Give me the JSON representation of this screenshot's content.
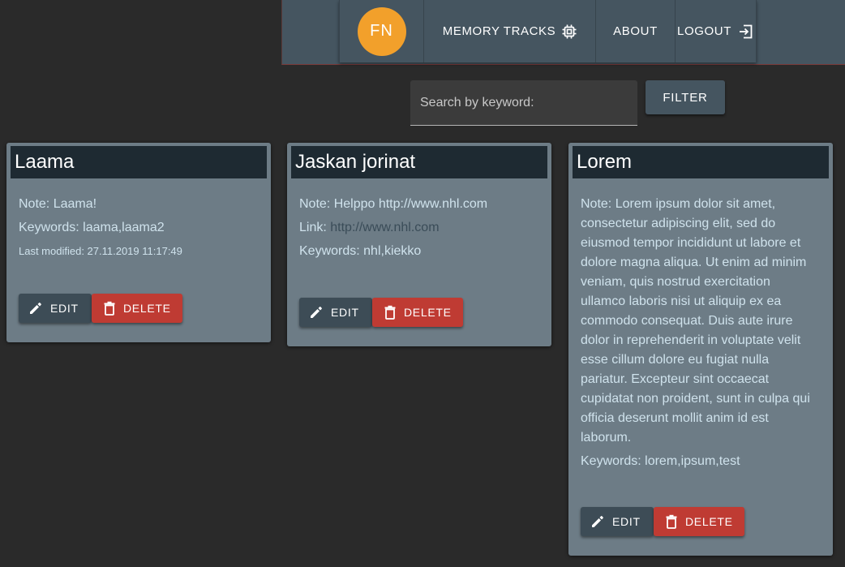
{
  "nav": {
    "avatar_initials": "FN",
    "memory_tracks_label": "MEMORY TRACKS",
    "about_label": "ABOUT",
    "logout_label": "LOGOUT",
    "icons": [
      "memory-chip-icon",
      "logout-icon"
    ]
  },
  "search": {
    "placeholder": "Search by keyword:",
    "value": "",
    "filter_label": "FILTER"
  },
  "cards": [
    {
      "title": "Laama",
      "note": "Note: Laama!",
      "keywords": "Keywords: laama,laama2",
      "modified": "Last modified: 27.11.2019 11:17:49"
    },
    {
      "title": "Jaskan jorinat",
      "note": "Note: Helppo http://www.nhl.com",
      "link_label": "Link: ",
      "link_url": "http://www.nhl.com",
      "keywords": "Keywords: nhl,kiekko"
    },
    {
      "title": "Lorem",
      "note_lines": [
        "Note: Lorem ipsum dolor sit amet,",
        "consectetur adipiscing elit, sed do",
        "eiusmod tempor incididunt ut labore et",
        "dolore magna aliqua. Ut enim ad minim",
        "veniam, quis nostrud exercitation",
        "ullamco laboris nisi ut aliquip ex ea",
        "commodo consequat. Duis aute irure",
        "dolor in reprehenderit in voluptate velit",
        "esse cillum dolore eu fugiat nulla",
        "pariatur. Excepteur sint occaecat",
        "cupidatat non proident, sunt in culpa qui",
        "officia deserunt mollit anim id est",
        "laborum."
      ],
      "keywords": "Keywords: lorem,ipsum,test"
    }
  ],
  "buttons": {
    "edit_label": "EDIT",
    "delete_label": "DELETE"
  },
  "colors": {
    "background": "#2a2a2a",
    "nav": "#455560",
    "avatar": "#f2a02b",
    "card": "#6d7c86",
    "card_title": "#1e2a32",
    "edit": "#3d4c56",
    "delete": "#bf3b33"
  }
}
